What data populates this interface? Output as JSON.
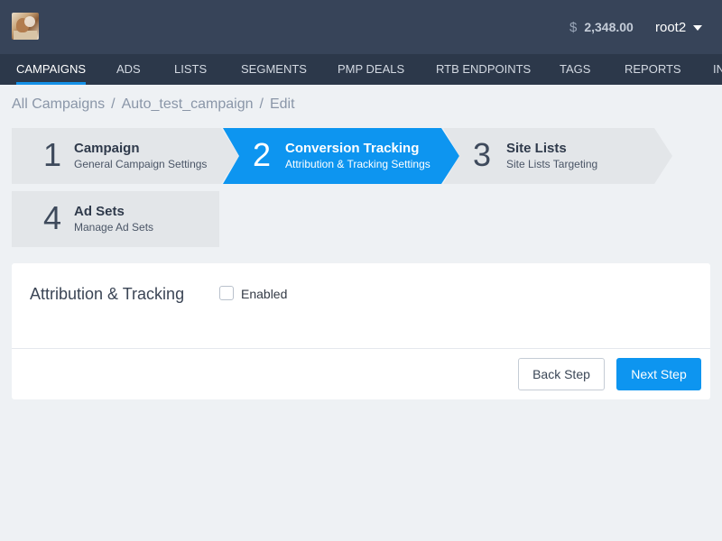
{
  "topbar": {
    "currency_symbol": "$",
    "balance": "2,348.00",
    "username": "root2"
  },
  "nav": {
    "items": [
      {
        "label": "CAMPAIGNS",
        "active": true
      },
      {
        "label": "ADS"
      },
      {
        "label": "LISTS"
      },
      {
        "label": "SEGMENTS"
      },
      {
        "label": "PMP DEALS"
      },
      {
        "label": "RTB ENDPOINTS"
      },
      {
        "label": "TAGS"
      },
      {
        "label": "REPORTS"
      },
      {
        "label": "IN"
      }
    ]
  },
  "breadcrumb": {
    "items": [
      "All Campaigns",
      "Auto_test_campaign",
      "Edit"
    ],
    "separator": "/"
  },
  "steps": [
    {
      "number": "1",
      "title": "Campaign",
      "subtitle": "General Campaign Settings"
    },
    {
      "number": "2",
      "title": "Conversion Tracking",
      "subtitle": "Attribution & Tracking Settings",
      "active": true
    },
    {
      "number": "3",
      "title": "Site Lists",
      "subtitle": "Site Lists Targeting"
    },
    {
      "number": "4",
      "title": "Ad Sets",
      "subtitle": "Manage Ad Sets"
    }
  ],
  "form": {
    "section_title": "Attribution & Tracking",
    "enabled_label": "Enabled",
    "enabled_checked": false
  },
  "actions": {
    "back_label": "Back Step",
    "next_label": "Next Step"
  },
  "colors": {
    "topbar_bg": "#374459",
    "navbar_bg": "#2c384a",
    "accent": "#0d95f0",
    "page_bg": "#eef1f4"
  }
}
